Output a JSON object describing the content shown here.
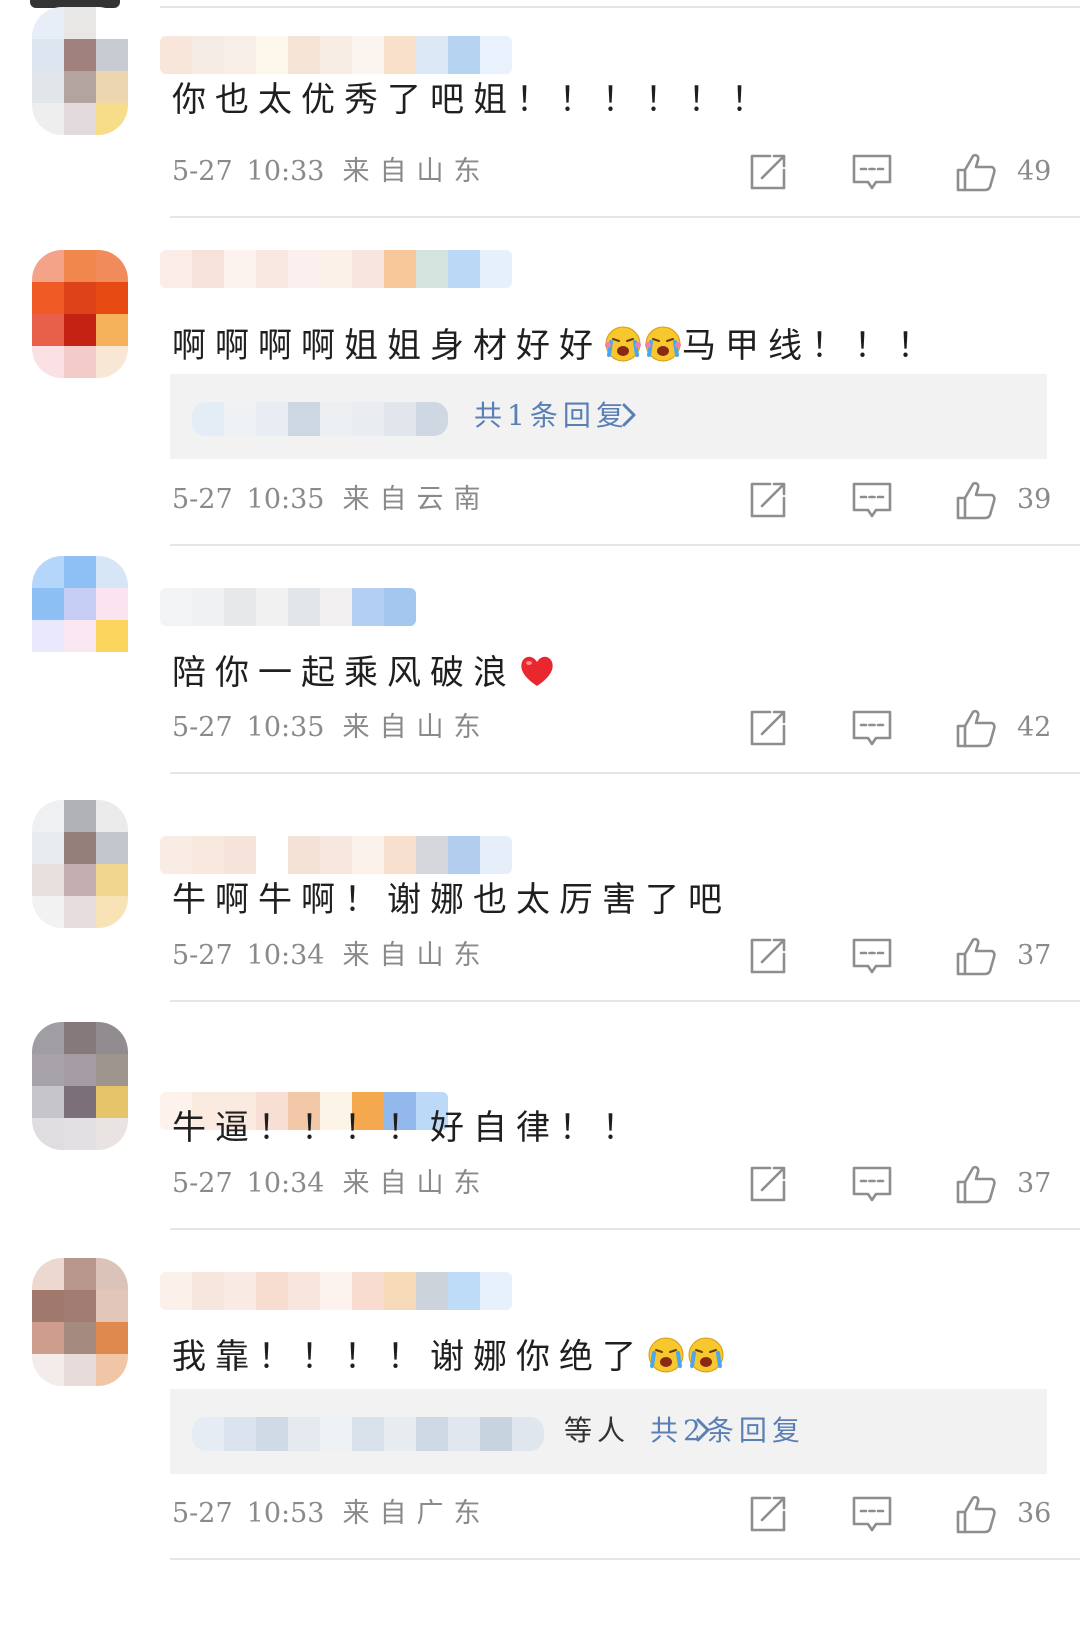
{
  "comments": [
    {
      "text": "你也太优秀了吧姐！！！！！！",
      "date": "5-27",
      "time": "10:33",
      "location": "来自山东",
      "likes": "49",
      "avatar_colors": [
        "#e8eef7",
        "#e9e6e6",
        "#ffffff",
        "#dde6f0",
        "#a0817e",
        "#c8ccd2",
        "#e0e6ea",
        "#b3a4a0",
        "#ecd6b0",
        "#eeeeee",
        "#e3dadd",
        "#f7dc8a"
      ],
      "name_colors": [
        "#f8e6db",
        "#f5ece6",
        "#f7efe7",
        "#fdf7ec",
        "#f5e3d6",
        "#f7ede5",
        "#fbf4ef",
        "#f8e0ca",
        "#dde8f6",
        "#b6d3f2",
        "#e8f1fc"
      ],
      "reply": null
    },
    {
      "text": "啊啊啊啊姐姐身材好好",
      "text_after": "马甲线！！！",
      "emojis_mid": 2,
      "emoji_type": "laugh-cry",
      "date": "5-27",
      "time": "10:35",
      "location": "来自云南",
      "likes": "39",
      "avatar_colors": [
        "#f4a388",
        "#f2874d",
        "#f18b5b",
        "#f05a24",
        "#de4218",
        "#e64a12",
        "#e8604a",
        "#c42313",
        "#f6b25b",
        "#fbe0e4",
        "#f3cbc9",
        "#f9e7d6"
      ],
      "name_colors": [
        "#fbece8",
        "#f7e2da",
        "#fcf3ee",
        "#f9e7e2",
        "#fbf0ef",
        "#fcf1e8",
        "#f8e5e0",
        "#f8c79a",
        "#d3e3dd",
        "#b9d9f6",
        "#e6f0fb"
      ],
      "reply": {
        "prefix": "",
        "summary": "共1条回复",
        "names_colors": [
          "#e4ecf5",
          "#eef2f5",
          "#e7edf2",
          "#cdd7e2",
          "#edf0f3",
          "#e9ecf0",
          "#e1e6ec",
          "#cfd7e2"
        ]
      }
    },
    {
      "text": "陪你一起乘风破浪",
      "emoji_end": "heart",
      "date": "5-27",
      "time": "10:35",
      "location": "来自山东",
      "likes": "42",
      "avatar_colors": [
        "#b3d6fa",
        "#8ebff5",
        "#d7e6f6",
        "#8cc0f5",
        "#c6cef5",
        "#fbe3ef",
        "#e9e8fd",
        "#fbe7f1",
        "#fbd55e",
        "#ffffff",
        "#ffffff",
        "#ffffff"
      ],
      "name_colors": [
        "#f3f4f5",
        "#f0f1f2",
        "#e7e8e9",
        "#f1f1f2",
        "#e3e6e8",
        "#f2eff1",
        "#b3cff2",
        "#a4c7f0"
      ],
      "reply": null
    },
    {
      "text": "牛啊牛啊！谢娜也太厉害了吧",
      "date": "5-27",
      "time": "10:34",
      "location": "来自山东",
      "likes": "37",
      "avatar_colors": [
        "#eef0f2",
        "#b0b2b6",
        "#ebebec",
        "#e8ebef",
        "#947e7a",
        "#c3c6cc",
        "#e8e0de",
        "#c4aeb0",
        "#f0d58e",
        "#f2f2f2",
        "#e7dddf",
        "#f7e3b6"
      ],
      "name_colors": [
        "#f9ece4",
        "#f8e8dd",
        "#f6e4da",
        "#ffffff",
        "#f5e2d6",
        "#f8e7df",
        "#fcf2ec",
        "#f7e0cd",
        "#d6d7dc",
        "#b2cdee",
        "#e6eefa"
      ],
      "reply": null
    },
    {
      "text": "牛逼！！！！好自律！！",
      "date": "5-27",
      "time": "10:34",
      "location": "来自山东",
      "likes": "37",
      "avatar_colors": [
        "#a09ea2",
        "#85797c",
        "#908c90",
        "#a8a3ab",
        "#a59ca3",
        "#9f958f",
        "#c6c5cb",
        "#7b6f78",
        "#e6c56a",
        "#dfdde0",
        "#e2e0e2",
        "#e9e4e2"
      ],
      "name_colors": [
        "#fdf3ec",
        "#fbeadf",
        "#fbeadf",
        "#f7e0d3",
        "#f2c8a8",
        "#fdf4e8",
        "#f4a94e",
        "#93b9ec",
        "#bcd9f8"
      ],
      "reply": null
    },
    {
      "text": "我靠！！！！谢娜你绝了",
      "emojis_end": 2,
      "emoji_type": "cry",
      "date": "5-27",
      "time": "10:53",
      "location": "来自广东",
      "likes": "36",
      "avatar_colors": [
        "#ecd8cf",
        "#b8968c",
        "#dbc3ba",
        "#a1796c",
        "#a27b73",
        "#e3c6ba",
        "#cf9d8d",
        "#a58a80",
        "#de8a4f",
        "#f4ecea",
        "#e7dcda",
        "#f1c6a6"
      ],
      "name_colors": [
        "#fcf0ea",
        "#f7e6dd",
        "#f9ebe3",
        "#f6ddd0",
        "#f8e6de",
        "#fcf2ee",
        "#f8dccf",
        "#f6d9b6",
        "#cdd3da",
        "#bedcf8",
        "#e7f1fc"
      ],
      "reply": {
        "prefix": "等人",
        "summary": "共2条回复",
        "names_colors": [
          "#e5ecf4",
          "#dbe4ee",
          "#cfdae6",
          "#e4eaf0",
          "#edf1f4",
          "#d9e1ea",
          "#e7ecf1",
          "#cfd9e5",
          "#e1e7ee",
          "#c8d3e0",
          "#dfe6ed"
        ]
      }
    }
  ]
}
